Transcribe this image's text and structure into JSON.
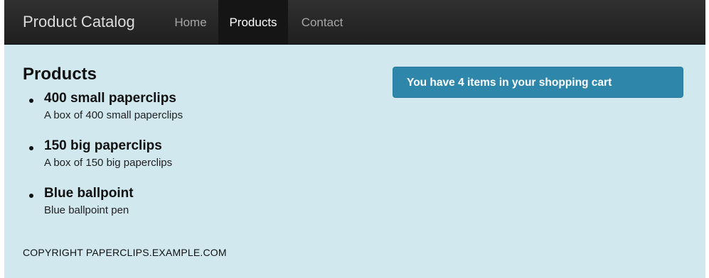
{
  "navbar": {
    "brand": "Product Catalog",
    "links": [
      "Home",
      "Products",
      "Contact"
    ],
    "active": "Products"
  },
  "main": {
    "heading": "Products",
    "products": [
      {
        "name": "400 small paperclips",
        "description": "A box of 400 small paperclips"
      },
      {
        "name": "150 big paperclips",
        "description": "A box of 150 big paperclips"
      },
      {
        "name": "Blue ballpoint",
        "description": "Blue ballpoint pen"
      }
    ]
  },
  "cart": {
    "message": "You have 4 items in your shopping cart"
  },
  "footer": {
    "text": "COPYRIGHT  PAPERCLIPS.EXAMPLE.COM"
  },
  "colors": {
    "navbar": "#1f1f1f",
    "page_background": "#d1e8ef",
    "cart_banner": "#2e87aa"
  }
}
